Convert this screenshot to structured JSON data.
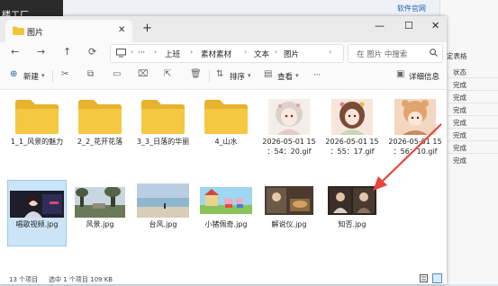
{
  "background": {
    "left_app_text": "楼工厂",
    "link": "软件官网",
    "sheet_header": "定表格",
    "sheet_cells": [
      "状态",
      "完成",
      "完成",
      "完成",
      "完成",
      "完成",
      "完成",
      "完成"
    ]
  },
  "window": {
    "tab_title": "图片",
    "tab_close": "✕",
    "new_tab": "+",
    "controls": {
      "minimize": "—",
      "maximize": "☐",
      "close": "✕"
    }
  },
  "nav": {
    "back": "←",
    "forward": "→",
    "up": "↑",
    "refresh": "⟳",
    "more": "···",
    "breadcrumbs": [
      "上班",
      "素材素材",
      "文本",
      "图片"
    ],
    "search_placeholder": "在 图片 中搜索"
  },
  "command_bar": {
    "new_label": "新建",
    "sort_label": "排序",
    "view_label": "查看",
    "more": "···",
    "details_label": "详细信息"
  },
  "items": [
    {
      "name": "1_1_风景的魅力",
      "type": "folder"
    },
    {
      "name": "2_2_花开花落",
      "type": "folder"
    },
    {
      "name": "3_3_日落的华丽",
      "type": "folder"
    },
    {
      "name": "4_山水",
      "type": "folder"
    },
    {
      "name": "2026-05-01 15：54：20.gif",
      "line1": "2026-05-01 15",
      "line2": "：54：20.gif",
      "type": "image"
    },
    {
      "name": "2026-05-01 15：55：17.gif",
      "line1": "2026-05-01 15",
      "line2": "：55：17.gif",
      "type": "image"
    },
    {
      "name": "2026-05-01 15：56：10.gif",
      "line1": "2026-05-01 15",
      "line2": "：56：10.gif",
      "type": "image"
    },
    {
      "name": "唱歌视频.jpg",
      "type": "image",
      "selected": true
    },
    {
      "name": "风景.jpg",
      "type": "image"
    },
    {
      "name": "台风.jpg",
      "type": "image"
    },
    {
      "name": "小猪佩奇.jpg",
      "type": "image"
    },
    {
      "name": "解说仪.jpg",
      "type": "image"
    },
    {
      "name": "知否.jpg",
      "type": "image"
    }
  ],
  "status": {
    "count": "13 个项目",
    "selection": "选中 1 个项目  109 KB"
  },
  "colors": {
    "folder": "#f2c33c",
    "selection": "#cce4f7",
    "arrow": "#e8453c",
    "accent": "#1a5fb4"
  }
}
